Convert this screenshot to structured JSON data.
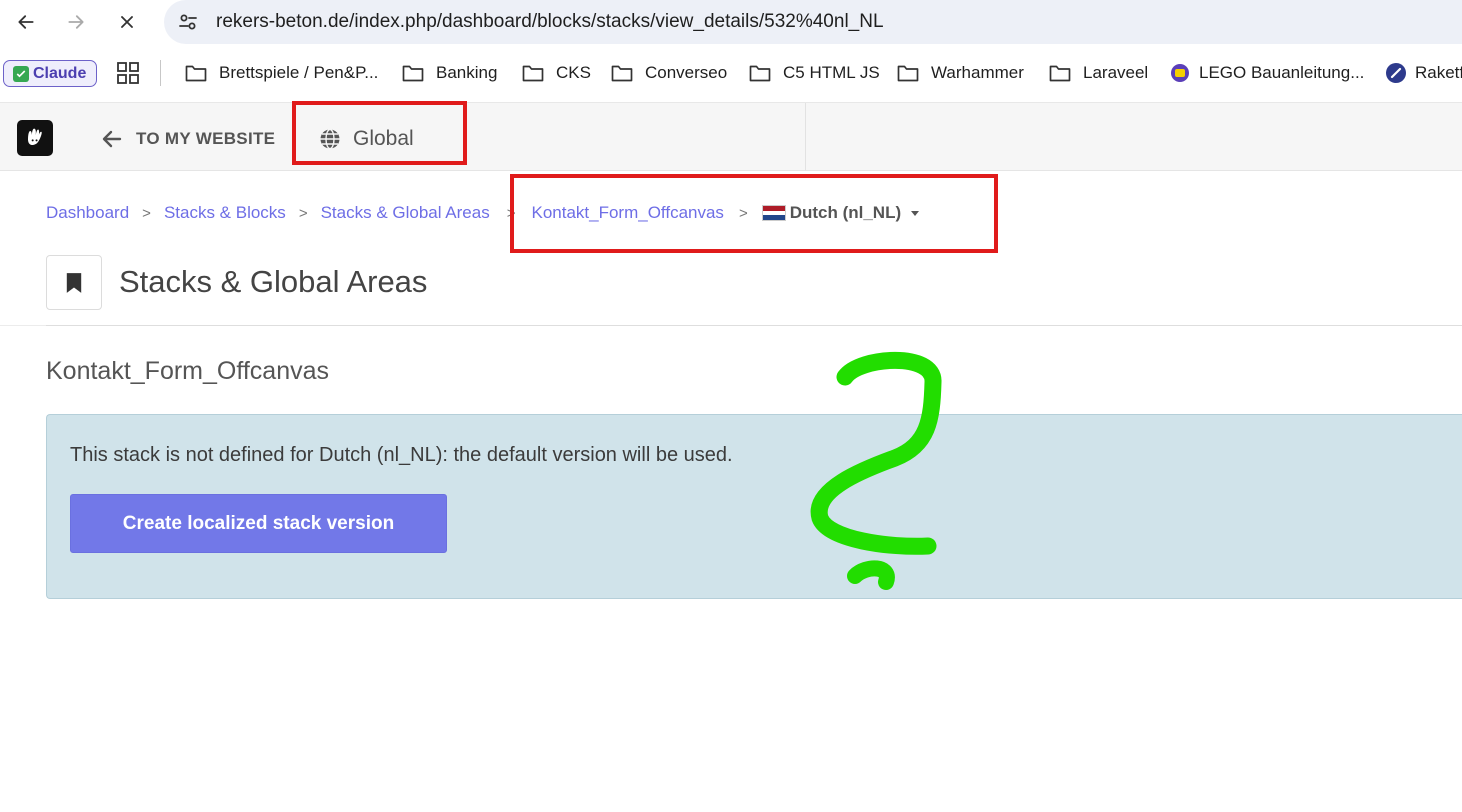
{
  "browser": {
    "url": "rekers-beton.de/index.php/dashboard/blocks/stacks/view_details/532%40nl_NL",
    "bookmarks": [
      {
        "label": "Claude",
        "icon": "claude-check-icon"
      },
      {
        "label": "Brettspiele / Pen&P...",
        "icon": "folder-icon"
      },
      {
        "label": "Banking",
        "icon": "folder-icon"
      },
      {
        "label": "CKS",
        "icon": "folder-icon"
      },
      {
        "label": "Converseo",
        "icon": "folder-icon"
      },
      {
        "label": "C5 HTML JS",
        "icon": "folder-icon"
      },
      {
        "label": "Warhammer",
        "icon": "folder-icon"
      },
      {
        "label": "Laraveel",
        "icon": "folder-icon"
      },
      {
        "label": "LEGO Bauanleitung...",
        "icon": "lego-icon"
      },
      {
        "label": "Raketf",
        "icon": "rocket-icon"
      }
    ]
  },
  "cms_toolbar": {
    "back_label": "TO MY WEBSITE",
    "global_label": "Global"
  },
  "breadcrumb": {
    "items": [
      "Dashboard",
      "Stacks & Blocks",
      "Stacks & Global Areas",
      "Kontakt_Form_Offcanvas"
    ],
    "separator": ">",
    "language": "Dutch (nl_NL)"
  },
  "page": {
    "title": "Stacks & Global Areas",
    "stack_name": "Kontakt_Form_Offcanvas",
    "alert_text": "This stack is not defined for Dutch (nl_NL): the default version will be used.",
    "create_button": "Create localized stack version"
  },
  "colors": {
    "annotation_red": "#e01b1b",
    "annotation_green": "#22dd00",
    "link": "#6e6ee6",
    "button": "#7278e8",
    "alert_bg": "#d0e3ea"
  }
}
